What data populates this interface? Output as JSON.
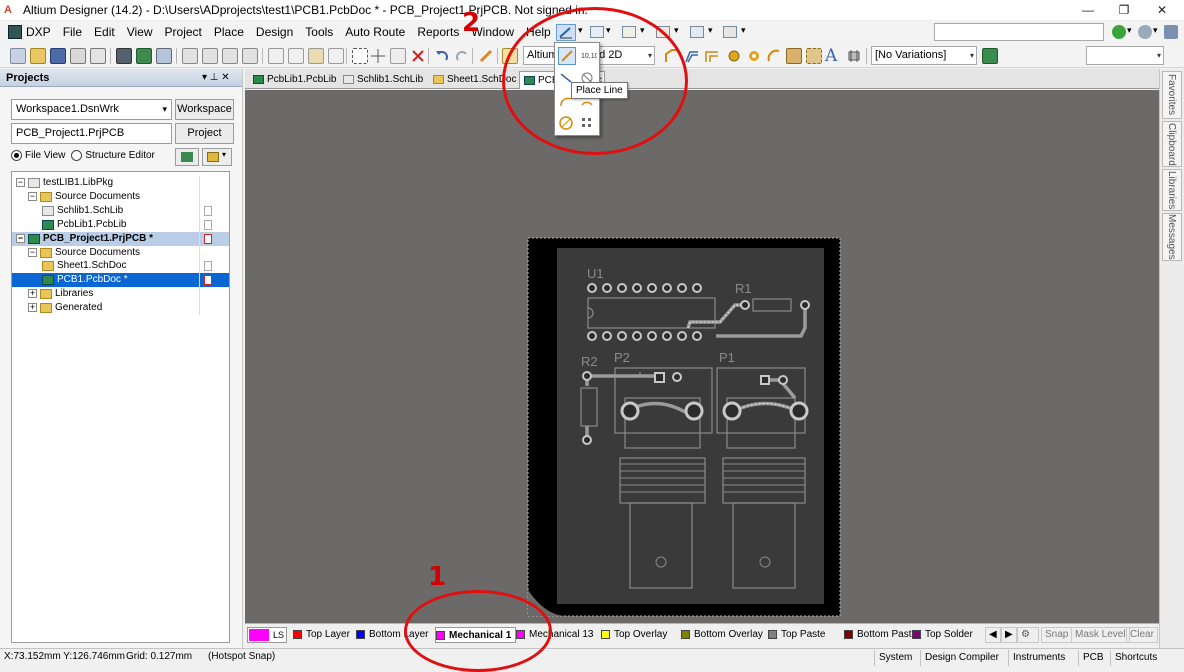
{
  "window": {
    "title": "Altium Designer (14.2) - D:\\Users\\ADprojects\\test1\\PCB1.PcbDoc * - PCB_Project1.PrjPCB. Not signed in.",
    "app_icon_letter": "A",
    "minimize_glyph": "—",
    "restore_glyph": "❐",
    "close_glyph": "✕"
  },
  "menu": {
    "items": [
      "DXP",
      "File",
      "Edit",
      "View",
      "Project",
      "Place",
      "Design",
      "Tools",
      "Auto Route",
      "Reports",
      "Window",
      "Help"
    ]
  },
  "toolbar": {
    "view_combo": "Altium Standard 2D",
    "variations_combo": "[No Variations]",
    "text_tool_glyph": "A",
    "dropdown_glyph": "▾"
  },
  "place_popup": {
    "tooltip": "Place Line",
    "selected_tool": "line-tool"
  },
  "projects_panel": {
    "title": "Projects",
    "pin_glyph": "▾ ⊥ ✕",
    "workspace_value": "Workspace1.DsnWrk",
    "workspace_button": "Workspace",
    "project_value": "PCB_Project1.PrjPCB",
    "project_button": "Project",
    "file_view_label": "File View",
    "structure_editor_label": "Structure Editor",
    "tree": [
      {
        "label": "testLIB1.LibPkg",
        "level": 0,
        "type": "libpkg",
        "expander": "−",
        "state": "normal"
      },
      {
        "label": "Source Documents",
        "level": 1,
        "type": "folder",
        "expander": "−",
        "state": "normal"
      },
      {
        "label": "Schlib1.SchLib",
        "level": 2,
        "type": "schlib",
        "expander": "",
        "state": "normal"
      },
      {
        "label": "PcbLib1.PcbLib",
        "level": 2,
        "type": "pcblib",
        "expander": "",
        "state": "normal"
      },
      {
        "label": "PCB_Project1.PrjPCB *",
        "level": 0,
        "type": "project",
        "expander": "−",
        "state": "project"
      },
      {
        "label": "Source Documents",
        "level": 1,
        "type": "folder",
        "expander": "−",
        "state": "normal"
      },
      {
        "label": "Sheet1.SchDoc",
        "level": 2,
        "type": "schdoc",
        "expander": "",
        "state": "normal"
      },
      {
        "label": "PCB1.PcbDoc *",
        "level": 2,
        "type": "pcbdoc",
        "expander": "",
        "state": "selected"
      },
      {
        "label": "Libraries",
        "level": 1,
        "type": "folder",
        "expander": "+",
        "state": "normal"
      },
      {
        "label": "Generated",
        "level": 1,
        "type": "folder",
        "expander": "+",
        "state": "normal"
      }
    ]
  },
  "document_tabs": [
    {
      "label": "PcbLib1.PcbLib",
      "active": false
    },
    {
      "label": "Schlib1.SchLib",
      "active": false
    },
    {
      "label": "Sheet1.SchDoc",
      "active": false
    },
    {
      "label": "PCB1.PcbDoc *",
      "active": true
    }
  ],
  "right_panel_tabs": [
    "Favorites",
    "Clipboard",
    "Libraries",
    "Messages"
  ],
  "pcb": {
    "designators": [
      "U1",
      "R1",
      "R2",
      "P2",
      "P1"
    ]
  },
  "layers": {
    "ls_label": "LS",
    "items": [
      {
        "name": "Top Layer",
        "color": "#ff0000",
        "active": false
      },
      {
        "name": "Bottom Layer",
        "color": "#0000ff",
        "active": false
      },
      {
        "name": "Mechanical 1",
        "color": "#ff00ff",
        "active": true
      },
      {
        "name": "Mechanical 13",
        "color": "#ff00ff",
        "active": false
      },
      {
        "name": "Top Overlay",
        "color": "#ffff00",
        "active": false
      },
      {
        "name": "Bottom Overlay",
        "color": "#808000",
        "active": false
      },
      {
        "name": "Top Paste",
        "color": "#808080",
        "active": false
      },
      {
        "name": "Bottom Paste",
        "color": "#800000",
        "active": false
      },
      {
        "name": "Top Solder",
        "color": "#800080",
        "active": false
      }
    ],
    "nav_prev": "◀",
    "nav_next": "▶",
    "snap_label": "Snap",
    "mask_level_label": "Mask Level",
    "clear_label": "Clear"
  },
  "status": {
    "coordinates": "X:73.152mm Y:126.746mm",
    "grid": "Grid: 0.127mm",
    "hotspot": "(Hotspot Snap)",
    "buttons": [
      "System",
      "Design Compiler",
      "Instruments",
      "PCB",
      "Shortcuts"
    ]
  },
  "annotations": {
    "label_1": "1",
    "label_2": "2",
    "color": "#e01010"
  }
}
